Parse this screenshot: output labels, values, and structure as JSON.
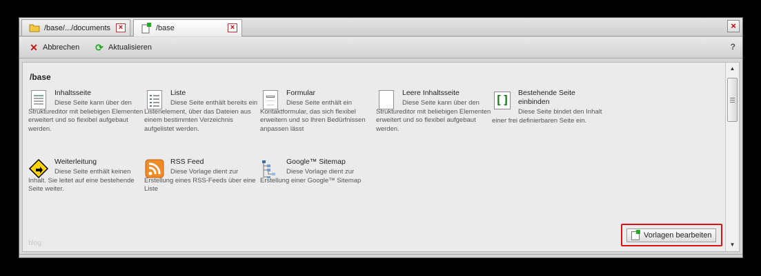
{
  "tabs": [
    {
      "label": "/base/.../documents",
      "icon": "folder-icon"
    },
    {
      "label": "/base",
      "icon": "new-document-icon"
    }
  ],
  "toolbar": {
    "cancel_label": "Abbrechen",
    "refresh_label": "Aktualisieren",
    "help_label": "?"
  },
  "content": {
    "path": "/base",
    "footer_hint": "blog",
    "edit_templates_label": "Vorlagen bearbeiten",
    "templates": [
      {
        "title": "Inhaltsseite",
        "desc": "Diese Seite kann über den Struktureditor mit beliebigen Elementen erweitert und so flexibel aufgebaut werden.",
        "icon": "content-page-icon"
      },
      {
        "title": "Liste",
        "desc": "Diese Seite enthält bereits ein Listenelement, über das Dateien aus einem bestimmten Verzeichnis aufgelistet werden.",
        "icon": "list-icon"
      },
      {
        "title": "Formular",
        "desc": "Diese Seite enthält ein Kontaktformular, das sich flexibel erweitern und so Ihren Bedürfnissen anpassen lässt",
        "icon": "form-icon"
      },
      {
        "title": "Leere Inhaltsseite",
        "desc": "Diese Seite kann über den Struktureditor mit beliebigen Elementen erweitert und so flexibel aufgebaut werden.",
        "icon": "empty-page-icon"
      },
      {
        "title": "Bestehende Seite einbinden",
        "desc": "Diese Seite bindet den Inhalt einer frei definierbaren Seite ein.",
        "icon": "embed-page-icon"
      },
      {
        "title": "Weiterleitung",
        "desc": "Diese Seite enthält keinen Inhalt. Sie leitet auf eine bestehende Seite weiter.",
        "icon": "redirect-icon"
      },
      {
        "title": "RSS Feed",
        "desc": "Diese Vorlage dient zur Erstellung eines RSS-Feeds über eine Liste",
        "icon": "rss-icon"
      },
      {
        "title": "Google™ Sitemap",
        "desc": "Diese Vorlage dient zur Erstellung einer Google™ Sitemap",
        "icon": "sitemap-icon"
      }
    ]
  },
  "colors": {
    "highlight": "#d11111",
    "cancel": "#cc1111",
    "refresh": "#22aa22"
  }
}
